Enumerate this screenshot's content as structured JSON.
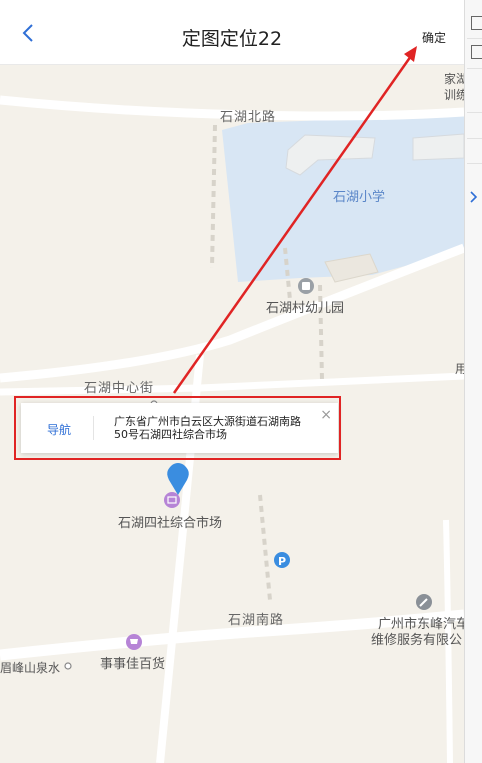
{
  "header": {
    "title": "定图定位22",
    "confirm_label": "确定"
  },
  "map": {
    "labels": {
      "north_road": "石湖北路",
      "school": "石湖小学",
      "kindergarten": "石湖村幼儿园",
      "center_street": "石湖中心街",
      "market": "石湖四社综合市场",
      "south_road": "石湖南路",
      "repair_line1": "广州市东峰汽车",
      "repair_line2": "维修服务有限公",
      "department_store": "事事佳百货",
      "spring": "眉峰山泉水",
      "training_line1": "家湖",
      "training_line2": "训练",
      "partial_right": "用"
    }
  },
  "popup": {
    "nav_label": "导航",
    "address": "广东省广州市白云区大源街道石湖南路50号石湖四社综合市场",
    "close_label": "×"
  },
  "colors": {
    "accent": "#2f6fd6",
    "annotation": "#e02424",
    "water": "#d8e6f4"
  }
}
